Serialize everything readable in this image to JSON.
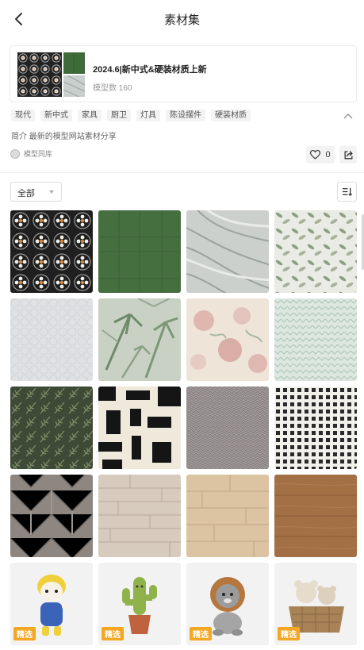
{
  "header": {
    "title": "素材集"
  },
  "collection": {
    "title": "2024.6|新中式&硬装材质上新",
    "count_text": "模型数 160"
  },
  "tags": [
    "现代",
    "新中式",
    "家具",
    "厨卫",
    "灯具",
    "陈设摆件",
    "硬装材质"
  ],
  "intro": "简介 最新的模型网站素材分享",
  "author": {
    "name": "模型同库"
  },
  "likes": {
    "count": "0"
  },
  "filter": {
    "label": "全部"
  },
  "grid": {
    "items": [
      {
        "icon": "floral-tile-texture",
        "badge": ""
      },
      {
        "icon": "green-panel-texture",
        "badge": ""
      },
      {
        "icon": "grey-marble-texture",
        "badge": ""
      },
      {
        "icon": "leaf-pattern-texture",
        "badge": ""
      },
      {
        "icon": "light-grey-fabric-texture",
        "badge": ""
      },
      {
        "icon": "palm-leaf-wallpaper-texture",
        "badge": ""
      },
      {
        "icon": "rose-floral-wallpaper-texture",
        "badge": ""
      },
      {
        "icon": "mint-herringbone-texture",
        "badge": ""
      },
      {
        "icon": "dark-fern-texture",
        "badge": ""
      },
      {
        "icon": "black-white-abstract-rug-texture",
        "badge": ""
      },
      {
        "icon": "grey-herringbone-fabric-texture",
        "badge": ""
      },
      {
        "icon": "check-grid-texture",
        "badge": ""
      },
      {
        "icon": "herringbone-wood-floor-texture",
        "badge": ""
      },
      {
        "icon": "light-wood-plank-texture",
        "badge": ""
      },
      {
        "icon": "natural-wood-plank-texture",
        "badge": ""
      },
      {
        "icon": "walnut-wood-plank-texture",
        "badge": ""
      },
      {
        "icon": "yellow-toy-figure",
        "badge": "精选"
      },
      {
        "icon": "cactus-pot-figure",
        "badge": "精选"
      },
      {
        "icon": "lion-toy-figure",
        "badge": "精选"
      },
      {
        "icon": "teddy-bear-basket-figure",
        "badge": "精选"
      }
    ]
  },
  "colors": {
    "badge": "#f5a623",
    "tag_bg": "#f3f3f3"
  }
}
